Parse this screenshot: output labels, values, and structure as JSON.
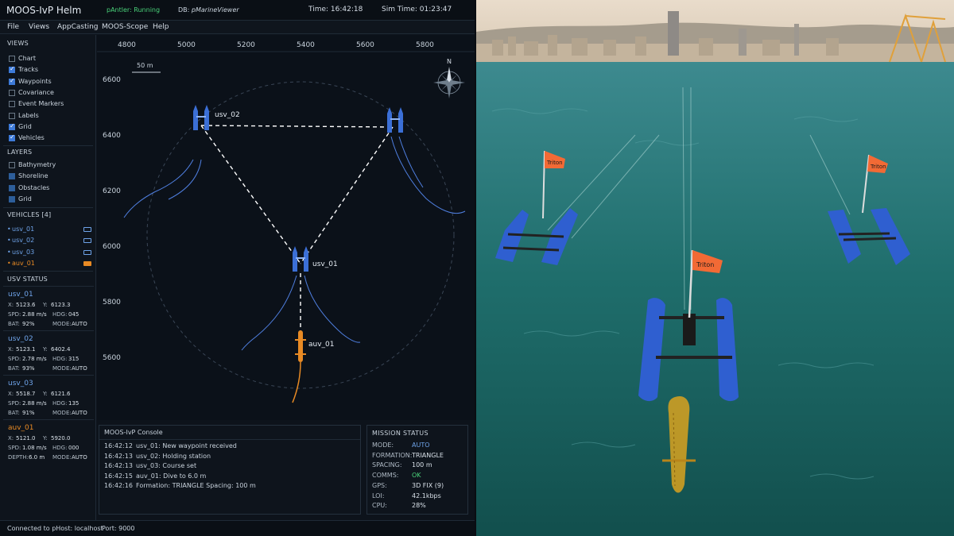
{
  "titlebar": {
    "app_title": "MOOS-IvP Helm",
    "antler_status": "pAntler: Running",
    "db_label": "DB:",
    "db_value": "pMarineViewer",
    "time": "Time: 16:42:18",
    "sim_time": "Sim Time: 01:23:47"
  },
  "menu": {
    "file": "File",
    "views": "Views",
    "appcasting": "AppCasting",
    "scope": "MOOS-Scope",
    "help": "Help"
  },
  "views": {
    "heading": "VIEWS",
    "items": [
      {
        "label": "Chart",
        "checked": false
      },
      {
        "label": "Tracks",
        "checked": true
      },
      {
        "label": "Waypoints",
        "checked": true
      },
      {
        "label": "Covariance",
        "checked": false
      },
      {
        "label": "Event Markers",
        "checked": false
      },
      {
        "label": "Labels",
        "checked": false
      },
      {
        "label": "Grid",
        "checked": true
      },
      {
        "label": "Vehicles",
        "checked": true
      }
    ]
  },
  "layers": {
    "heading": "LAYERS",
    "items": [
      {
        "label": "Bathymetry",
        "checked": false
      },
      {
        "label": "Shoreline",
        "checked": true
      },
      {
        "label": "Obstacles",
        "checked": true
      },
      {
        "label": "Grid",
        "checked": true
      }
    ]
  },
  "vehicles": {
    "heading": "VEHICLES [4]",
    "items": [
      {
        "bullet": "•",
        "name": "usv_01",
        "color": "#6fa4ea"
      },
      {
        "bullet": "•",
        "name": "usv_02",
        "color": "#6fa4ea"
      },
      {
        "bullet": "•",
        "name": "usv_03",
        "color": "#6fa4ea"
      },
      {
        "bullet": "•",
        "name": "auv_01",
        "color": "#e88a24"
      }
    ]
  },
  "usv_status": {
    "heading": "USV STATUS",
    "cards": [
      {
        "name": "usv_01",
        "x": "5123.6",
        "y": "6123.3",
        "spd": "2.88 m/s",
        "hdg": "045",
        "bat": "92%",
        "mode": "AUTO"
      },
      {
        "name": "usv_02",
        "x": "5123.1",
        "y": "6402.4",
        "spd": "2.78 m/s",
        "hdg": "315",
        "bat": "93%",
        "mode": "AUTO"
      },
      {
        "name": "usv_03",
        "x": "5518.7",
        "y": "6121.6",
        "spd": "2.88 m/s",
        "hdg": "135",
        "bat": "91%",
        "mode": "AUTO"
      }
    ],
    "auv": {
      "name": "auv_01",
      "x": "5121.0",
      "y": "5920.0",
      "spd": "1.08 m/s",
      "hdg": "000",
      "depth": "6.0 m",
      "mode": "AUTO"
    }
  },
  "labels": {
    "x": "X:",
    "y": "Y:",
    "spd": "SPD:",
    "hdg": "HDG:",
    "bat": "BAT:",
    "mode": "MODE:",
    "depth": "DEPTH:"
  },
  "map": {
    "x_ticks": [
      "4800",
      "5000",
      "5200",
      "5400",
      "5600",
      "5800"
    ],
    "y_ticks": [
      "6600",
      "6400",
      "6200",
      "6000",
      "5800",
      "5600"
    ],
    "scale_label": "50 m",
    "compass_north": "N",
    "vehicle_labels": {
      "usv_01": "usv_01",
      "usv_02": "usv_02",
      "auv_01": "auv_01"
    },
    "colors": {
      "usv": "#3b6fd6",
      "track": "#4f7fe0",
      "auv": "#e88a24",
      "formation": "#ffffff",
      "grid_circle": "#3a4656"
    }
  },
  "console": {
    "heading": "MOOS-IvP Console",
    "rows": [
      {
        "t": "16:42:12",
        "msg": "usv_01: New waypoint received"
      },
      {
        "t": "16:42:13",
        "msg": "usv_02: Holding station"
      },
      {
        "t": "16:42:13",
        "msg": "usv_03: Course set"
      },
      {
        "t": "16:42:15",
        "msg": "auv_01: Dive to 6.0 m"
      },
      {
        "t": "16:42:16",
        "msg": "Formation: TRIANGLE    Spacing: 100 m"
      }
    ]
  },
  "mission": {
    "heading": "MISSION STATUS",
    "rows": [
      {
        "k": "MODE:",
        "v": "AUTO",
        "style": "hl"
      },
      {
        "k": "FORMATION:",
        "v": "TRIANGLE",
        "style": ""
      },
      {
        "k": "SPACING:",
        "v": "100 m",
        "style": ""
      },
      {
        "k": "COMMS:",
        "v": "OK",
        "style": "ok"
      },
      {
        "k": "GPS:",
        "v": "3D FIX (9)",
        "style": ""
      },
      {
        "k": "LOI:",
        "v": "42.1kbps",
        "style": ""
      },
      {
        "k": "CPU:",
        "v": "28%",
        "style": ""
      }
    ]
  },
  "statusbar": {
    "connected": "Connected to pHost: localhost",
    "port": "Port: 9000"
  },
  "photo": {
    "flag_text": "Triton",
    "colors": {
      "sea": "#1f6e6c",
      "sky": "#e9dccb",
      "hull": "#2f5fd0",
      "flag": "#f26a35",
      "auv": "#d9a21e"
    }
  }
}
